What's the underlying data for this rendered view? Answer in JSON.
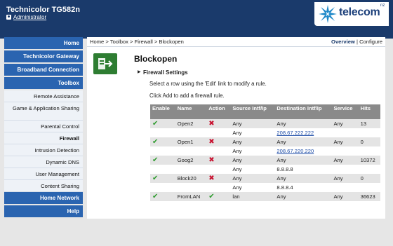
{
  "header": {
    "title": "Technicolor TG582n",
    "user": "Administrator",
    "logo_text": "telecom",
    "logo_sup": "nz"
  },
  "nav": {
    "items": [
      {
        "label": "Home",
        "type": "main"
      },
      {
        "label": "Technicolor Gateway",
        "type": "main"
      },
      {
        "label": "Broadband Connection",
        "type": "main"
      },
      {
        "label": "Toolbox",
        "type": "main"
      },
      {
        "label": "Remote Assistance",
        "type": "sub"
      },
      {
        "label": "Game & Application Sharing",
        "type": "sub2"
      },
      {
        "label": "Parental Control",
        "type": "sub"
      },
      {
        "label": "Firewall",
        "type": "current"
      },
      {
        "label": "Intrusion Detection",
        "type": "sub"
      },
      {
        "label": "Dynamic DNS",
        "type": "sub"
      },
      {
        "label": "User Management",
        "type": "sub"
      },
      {
        "label": "Content Sharing",
        "type": "sub"
      },
      {
        "label": "Home Network",
        "type": "main"
      },
      {
        "label": "Help",
        "type": "main"
      }
    ]
  },
  "breadcrumb": "Home > Toolbox > Firewall > Blockopen",
  "topnav": {
    "overview": "Overview",
    "sep": "|",
    "configure": "Configure"
  },
  "page": {
    "title": "Blockopen",
    "section": "Firewall Settings",
    "hint1": "Select a row using the 'Edit' link to modify a rule.",
    "hint2": "Click Add to add a firewall rule."
  },
  "table": {
    "headers": [
      "Enable",
      "Name",
      "Action",
      "Source Intf/Ip",
      "Destination Intf/Ip",
      "Service",
      "Hits"
    ],
    "rules": [
      {
        "name": "Open2",
        "action": "deny",
        "src_intf": "Any",
        "src_ip": "Any",
        "dst_intf": "Any",
        "dst_ip": "208.67.222.222",
        "dst_link": true,
        "service": "Any",
        "hits": "13"
      },
      {
        "name": "Open1",
        "action": "deny",
        "src_intf": "Any",
        "src_ip": "Any",
        "dst_intf": "Any",
        "dst_ip": "208.67.220.220",
        "dst_link": true,
        "service": "Any",
        "hits": "0"
      },
      {
        "name": "Goog2",
        "action": "deny",
        "src_intf": "Any",
        "src_ip": "Any",
        "dst_intf": "Any",
        "dst_ip": "8.8.8.8",
        "dst_link": false,
        "service": "Any",
        "hits": "10372"
      },
      {
        "name": "Block20",
        "action": "deny",
        "src_intf": "Any",
        "src_ip": "Any",
        "dst_intf": "Any",
        "dst_ip": "8.8.8.4",
        "dst_link": false,
        "service": "Any",
        "hits": "0"
      },
      {
        "name": "FromLAN",
        "action": "allow",
        "src_intf": "lan",
        "src_ip": null,
        "dst_intf": "Any",
        "dst_ip": null,
        "dst_link": false,
        "service": "Any",
        "hits": "36623"
      }
    ]
  },
  "icons": {
    "enabled": "check-icon",
    "deny": "x-icon",
    "allow": "check-icon"
  },
  "colors": {
    "header": "#1a3a6b",
    "nav_main": "#2a64b0",
    "accent_green": "#2e9b2e",
    "deny_red": "#c8102e"
  }
}
